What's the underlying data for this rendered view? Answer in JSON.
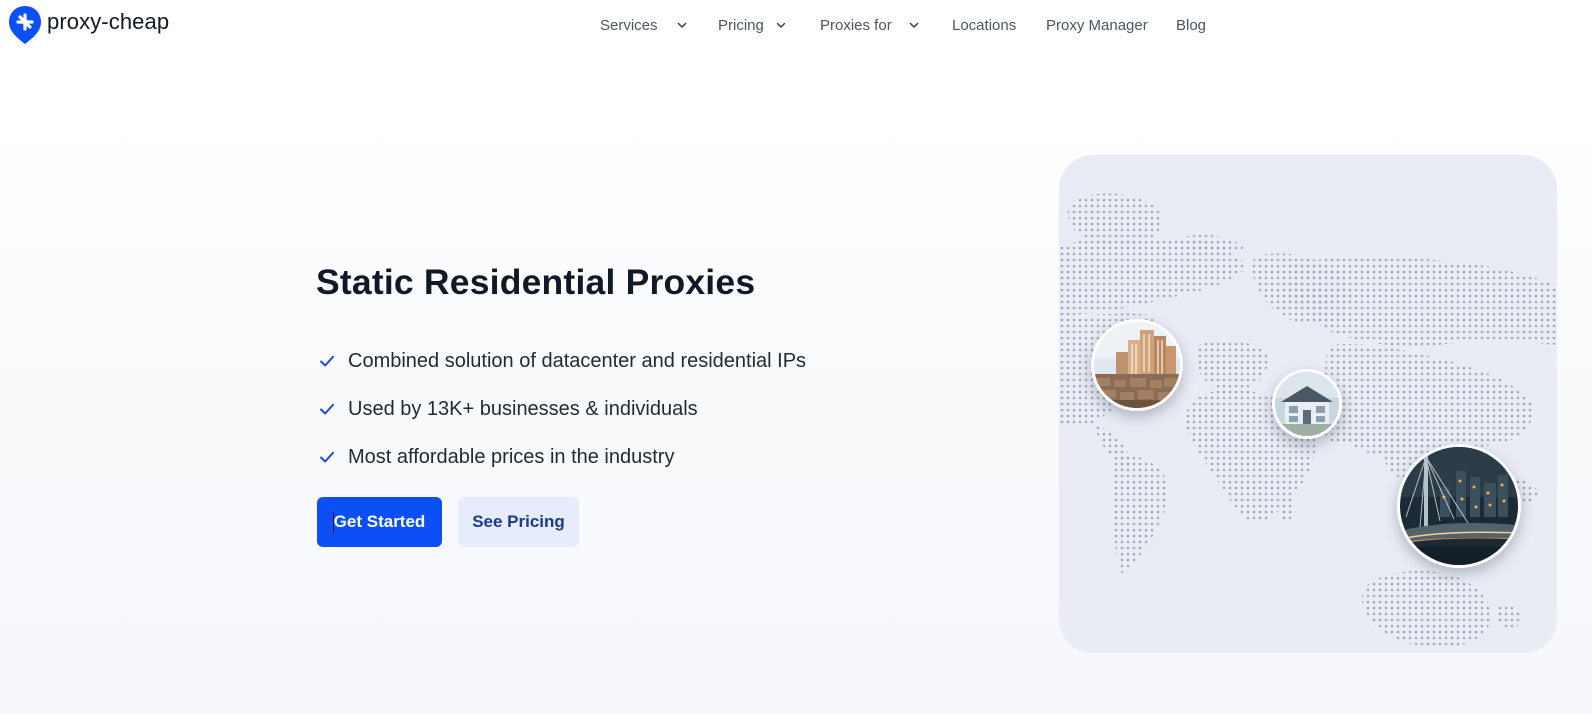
{
  "brand": {
    "name": "proxy-cheap",
    "accent_color": "#0b4ff5",
    "logo_icon": "map-pin-sparkle-icon"
  },
  "nav": {
    "items": [
      {
        "label": "Services",
        "has_dropdown": true
      },
      {
        "label": "Pricing",
        "has_dropdown": true
      },
      {
        "label": "Proxies for",
        "has_dropdown": true
      },
      {
        "label": "Locations",
        "has_dropdown": false
      },
      {
        "label": "Proxy Manager",
        "has_dropdown": false
      },
      {
        "label": "Blog",
        "has_dropdown": false
      }
    ],
    "dropdown_icon": "chevron-down-icon"
  },
  "hero": {
    "title": "Static Residential Proxies",
    "features": [
      "Combined solution of datacenter and residential IPs",
      "Used by 13K+ businesses & individuals",
      "Most affordable prices in the industry"
    ],
    "feature_icon": "check-icon",
    "feature_icon_color": "#1d4ed8",
    "primary_button": "Get Started",
    "secondary_button": "See Pricing"
  },
  "map": {
    "background_color": "#e9ecf5",
    "dot_color": "#a3a8b6",
    "photos": [
      "city-skyline-photo",
      "house-photo",
      "night-bridge-city-photo"
    ]
  }
}
